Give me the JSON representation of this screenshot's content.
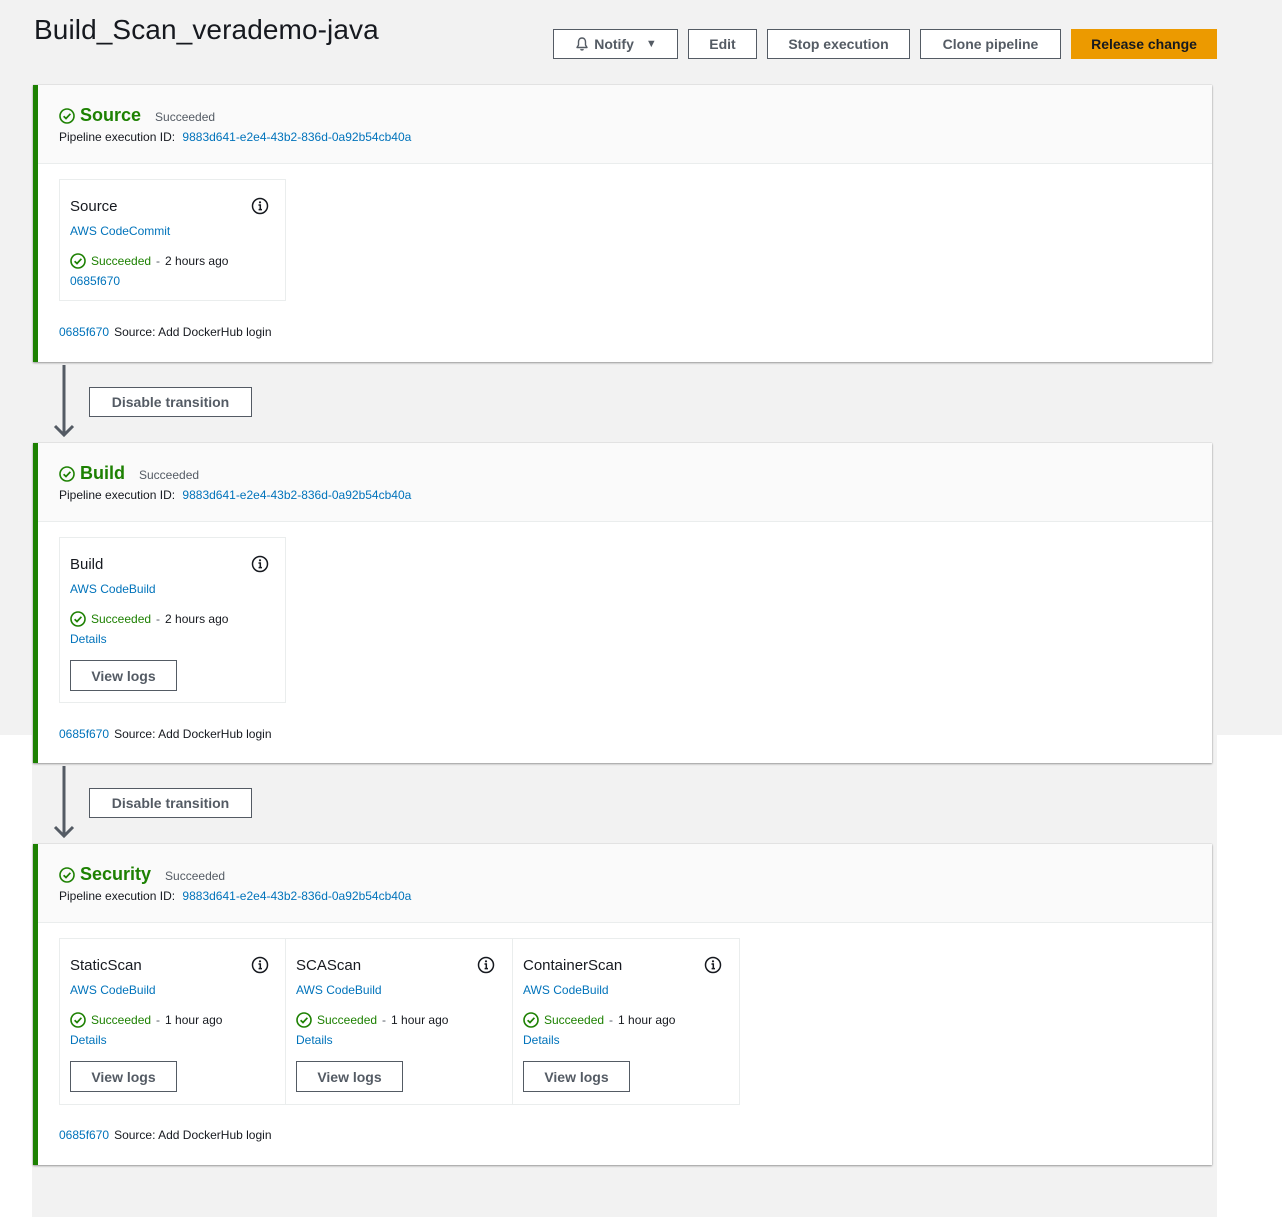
{
  "page": {
    "title": "Build_Scan_verademo-java"
  },
  "toolbar": {
    "notify": "Notify",
    "edit": "Edit",
    "stop": "Stop execution",
    "clone": "Clone pipeline",
    "release": "Release change"
  },
  "colors": {
    "success": "#1d8102",
    "link": "#0073bb",
    "primary": "#ec9a00"
  },
  "transitions": [
    {
      "label": "Disable transition"
    },
    {
      "label": "Disable transition"
    }
  ],
  "stages": [
    {
      "name": "Source",
      "status": "Succeeded",
      "exec_label": "Pipeline execution ID:",
      "exec_id": "9883d641-e2e4-43b2-836d-0a92b54cb40a",
      "actions": [
        {
          "name": "Source",
          "provider": "AWS CodeCommit",
          "status": "Succeeded",
          "time": "2 hours ago",
          "link": "0685f670"
        }
      ],
      "revision": {
        "id": "0685f670",
        "message": "Source: Add DockerHub login"
      }
    },
    {
      "name": "Build",
      "status": "Succeeded",
      "exec_label": "Pipeline execution ID:",
      "exec_id": "9883d641-e2e4-43b2-836d-0a92b54cb40a",
      "actions": [
        {
          "name": "Build",
          "provider": "AWS CodeBuild",
          "status": "Succeeded",
          "time": "2 hours ago",
          "link": "Details",
          "button": "View logs"
        }
      ],
      "revision": {
        "id": "0685f670",
        "message": "Source: Add DockerHub login"
      }
    },
    {
      "name": "Security",
      "status": "Succeeded",
      "exec_label": "Pipeline execution ID:",
      "exec_id": "9883d641-e2e4-43b2-836d-0a92b54cb40a",
      "actions": [
        {
          "name": "StaticScan",
          "provider": "AWS CodeBuild",
          "status": "Succeeded",
          "time": "1 hour ago",
          "link": "Details",
          "button": "View logs"
        },
        {
          "name": "SCAScan",
          "provider": "AWS CodeBuild",
          "status": "Succeeded",
          "time": "1 hour ago",
          "link": "Details",
          "button": "View logs"
        },
        {
          "name": "ContainerScan",
          "provider": "AWS CodeBuild",
          "status": "Succeeded",
          "time": "1 hour ago",
          "link": "Details",
          "button": "View logs"
        }
      ],
      "revision": {
        "id": "0685f670",
        "message": "Source: Add DockerHub login"
      }
    }
  ]
}
